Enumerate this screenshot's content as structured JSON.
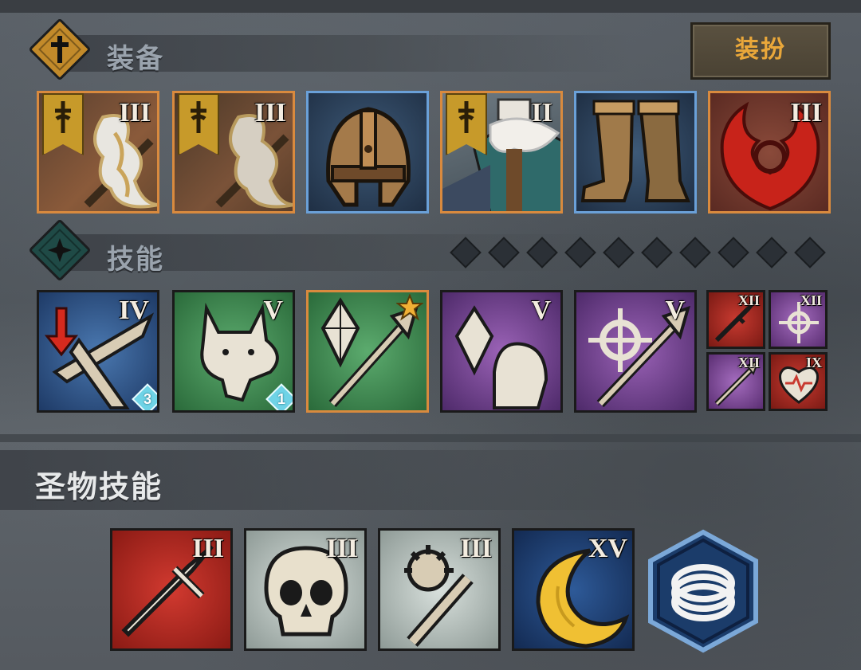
{
  "equipment": {
    "title": "装备",
    "dress_button": "装扮",
    "items": [
      {
        "name": "white-flame-weapon",
        "tier": "III",
        "rarity": "orange",
        "banner": true
      },
      {
        "name": "white-flame-weapon",
        "tier": "III",
        "rarity": "orange",
        "banner": true
      },
      {
        "name": "leather-helmet",
        "tier": "",
        "rarity": "blue",
        "banner": false
      },
      {
        "name": "fur-armor",
        "tier": "II",
        "rarity": "orange",
        "banner": true
      },
      {
        "name": "leather-boots",
        "tier": "",
        "rarity": "blue",
        "banner": false
      },
      {
        "name": "red-flame-emblem",
        "tier": "III",
        "rarity": "orange",
        "banner": false
      }
    ]
  },
  "skills": {
    "title": "技能",
    "pips_count": 10,
    "items": [
      {
        "name": "debuff-blades-skill",
        "tier": "IV",
        "bg": "blue",
        "badge": "3"
      },
      {
        "name": "wolf-skill",
        "tier": "V",
        "bg": "green",
        "badge": "1"
      },
      {
        "name": "crystal-spear-skill",
        "tier": "",
        "bg": "green",
        "star": true
      },
      {
        "name": "crystal-tombstone-skill",
        "tier": "V",
        "bg": "purple"
      },
      {
        "name": "crosshair-spear-skill",
        "tier": "V",
        "bg": "purple"
      }
    ],
    "mini": [
      {
        "name": "red-sword-mini",
        "tier": "XII",
        "bg": "red"
      },
      {
        "name": "purple-crosshair-mini",
        "tier": "XII",
        "bg": "purple"
      },
      {
        "name": "purple-spear-mini",
        "tier": "XII",
        "bg": "purple"
      },
      {
        "name": "red-heart-mini",
        "tier": "IX",
        "bg": "red"
      }
    ]
  },
  "relic": {
    "title": "圣物技能",
    "items": [
      {
        "name": "red-sword-relic",
        "tier": "III",
        "bg": "red"
      },
      {
        "name": "skull-relic",
        "tier": "III",
        "bg": "gray"
      },
      {
        "name": "mace-relic",
        "tier": "III",
        "bg": "gray"
      },
      {
        "name": "crescent-relic",
        "tier": "XV",
        "bg": "navy"
      },
      {
        "name": "ring-hex",
        "tier": "",
        "bg": "hex"
      }
    ]
  },
  "colors": {
    "orange": "#d98a3e",
    "blue": "#6aa0d8",
    "gold": "#e9a73a"
  }
}
